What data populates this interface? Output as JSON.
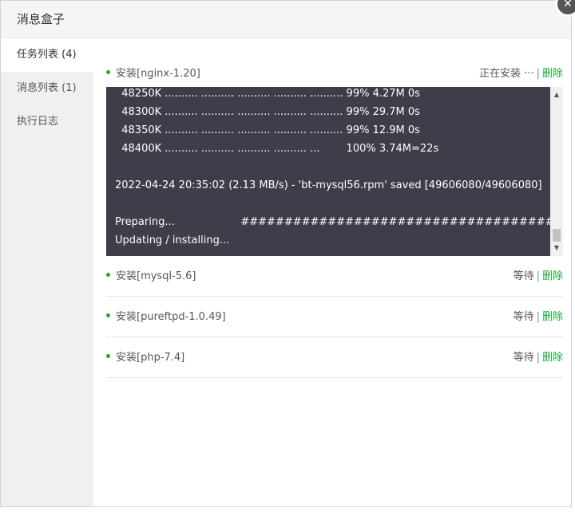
{
  "dialog": {
    "title": "消息盒子",
    "close_glyph": "✕"
  },
  "sidebar": {
    "items": [
      {
        "label": "任务列表 (4)",
        "active": true
      },
      {
        "label": "消息列表 (1)",
        "active": false
      },
      {
        "label": "执行日志",
        "active": false
      }
    ]
  },
  "tasks": [
    {
      "name": "安装[nginx-1.20]",
      "status": "正在安装 ···",
      "separator": "|",
      "delete_label": "删除"
    },
    {
      "name": "安装[mysql-5.6]",
      "status": "等待",
      "separator": "|",
      "delete_label": "删除"
    },
    {
      "name": "安装[pureftpd-1.0.49]",
      "status": "等待",
      "separator": "|",
      "delete_label": "删除"
    },
    {
      "name": "安装[php-7.4]",
      "status": "等待",
      "separator": "|",
      "delete_label": "删除"
    }
  ],
  "log": {
    "lines": [
      "  48250K .......... .......... .......... .......... .......... 99% 4.27M 0s",
      "  48300K .......... .......... .......... .......... .......... 99% 29.7M 0s",
      "  48350K .......... .......... .......... .......... .......... 99% 12.9M 0s",
      "  48400K .......... .......... .......... .......... ...        100% 3.74M=22s",
      "",
      "2022-04-24 20:35:02 (2.13 MB/s) - 'bt-mysql56.rpm' saved [49606080/49606080]",
      "",
      "Preparing...                    ################################################",
      "Updating / installing..."
    ],
    "scroll_up_glyph": "▲",
    "scroll_down_glyph": "▼"
  },
  "colors": {
    "accent": "#20a53a",
    "log_background": "#3e3d4a"
  }
}
